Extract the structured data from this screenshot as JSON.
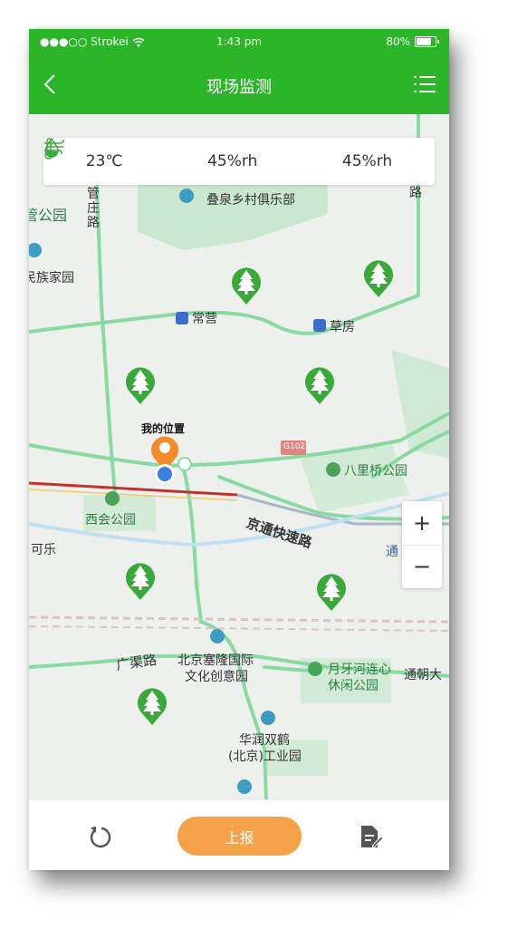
{
  "status_bar": {
    "carrier": "●●●○○ Strokei",
    "time": "1:43 pm",
    "battery": "80%",
    "battery_level": 0.8
  },
  "navbar": {
    "title": "现场监测",
    "back_icon": "chevron-left-icon",
    "menu_icon": "list-menu-icon"
  },
  "weather": {
    "temperature": "23℃",
    "humidity": "45%rh",
    "wind": "45%rh",
    "icons": [
      "thermometer-icon",
      "water-drop-icon",
      "wind-icon"
    ]
  },
  "map": {
    "labels": {
      "guanzhuang_road": "管\n庄\n路",
      "park_left": "管公园",
      "dieqian_club": "叠泉乡村俱乐部",
      "minzu_garden": "民族家园",
      "changying": "常营",
      "caofang": "草房",
      "road_right": "路",
      "my_location": "我的位置",
      "g102": "G102",
      "balizhuang_park": "八里桥公园",
      "xihui_park": "西会公园",
      "jingtong_expressway": "京通快速路",
      "kele": "可乐",
      "tong_partial": "通",
      "guangqu_road": "广渠路",
      "saidong": "北京塞隆国际",
      "wenhua": "文化创意园",
      "yueyahe_1": "月牙河连心",
      "yueyahe_2": "休闲公园",
      "tongchao": "通朝大",
      "huarun_1": "华润双鹤",
      "huarun_2": "(北京)工业园"
    },
    "zoom_in": "+",
    "zoom_out": "−"
  },
  "bottom": {
    "report_label": "上报",
    "refresh_icon": "refresh-icon",
    "doc_icon": "edit-document-icon"
  },
  "colors": {
    "brand_green": "#2db52a",
    "report_orange": "#f5a14a",
    "pin_green": "#3aa83a",
    "road_green": "#7fd69a"
  }
}
